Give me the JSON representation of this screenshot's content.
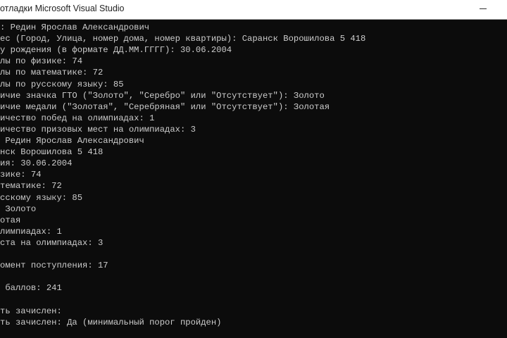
{
  "window": {
    "title": "отладки Microsoft Visual Studio"
  },
  "console": {
    "lines": [
      ": Редин Ярослав Александрович",
      "ес (Город, Улица, номер дома, номер квартиры): Саранск Ворошилова 5 418",
      "у рождения (в формате ДД.ММ.ГГГГ): 30.06.2004",
      "лы по физике: 74",
      "лы по математике: 72",
      "лы по русскому языку: 85",
      "ичие значка ГТО (\"Золото\", \"Серебро\" или \"Отсутствует\"): Золото",
      "ичие медали (\"Золотая\", \"Серебряная\" или \"Отсутствует\"): Золотая",
      "ичество побед на олимпиадах: 1",
      "ичество призовых мест на олимпиадах: 3",
      " Редин Ярослав Александрович",
      "нск Ворошилова 5 418",
      "ия: 30.06.2004",
      "зике: 74",
      "тематике: 72",
      "сскому языку: 85",
      " Золото",
      "отая",
      "лимпиадах: 1",
      "ста на олимпиадах: 3",
      "",
      "омент поступления: 17",
      "",
      " баллов: 241",
      "",
      "ть зачислен:",
      "ть зачислен: Да (минимальный порог пройден)"
    ]
  }
}
